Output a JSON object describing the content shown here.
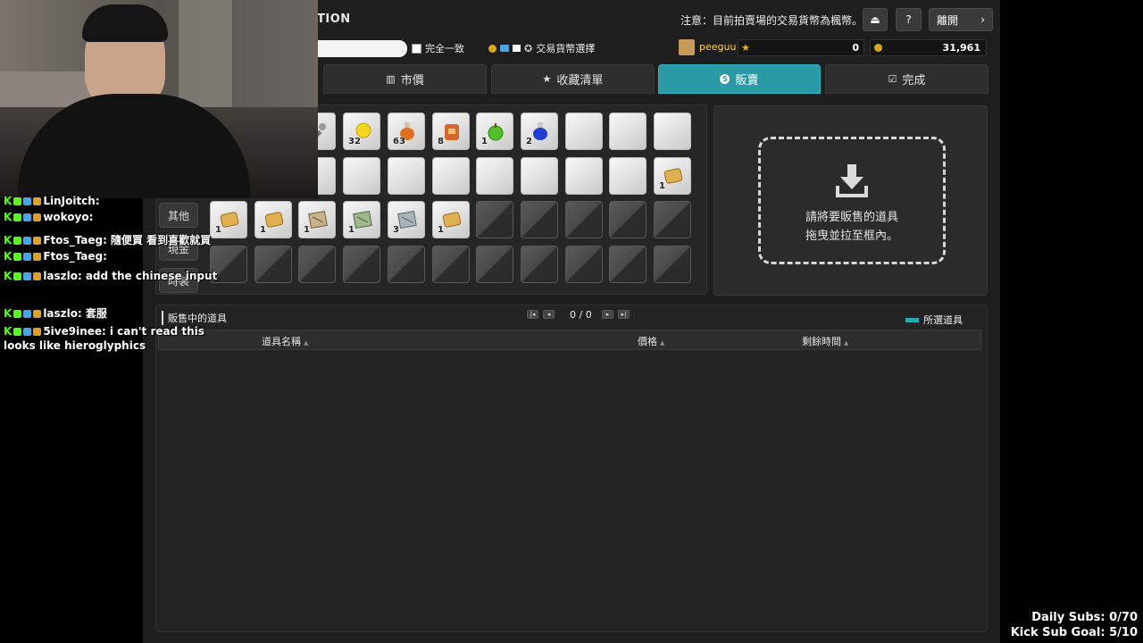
{
  "window": {
    "title": "TION",
    "notice": "注意：目前拍賣場的交易貨幣為楓幣。",
    "leave_label": "離開",
    "help_label": "?"
  },
  "search": {
    "exact_match_label": "完全一致",
    "currency_select_label": "交易貨幣選擇"
  },
  "account": {
    "username": "peeguu",
    "star_points": "0",
    "mesos": "31,961"
  },
  "tabs": [
    {
      "label": "市價",
      "icon": "bar-chart-icon"
    },
    {
      "label": "收藏清單",
      "icon": "star-icon"
    },
    {
      "label": "販賣",
      "icon": "coin-s-icon",
      "active": true
    },
    {
      "label": "完成",
      "icon": "checkbox-icon"
    }
  ],
  "inventory": {
    "side_tabs": [
      "其他",
      "現金",
      "時裝"
    ],
    "rows": [
      [
        {
          "type": "tool",
          "qty": ""
        },
        {
          "type": "yellow-orb",
          "qty": "32"
        },
        {
          "type": "potion-orange",
          "qty": "63"
        },
        {
          "type": "bag-orange",
          "qty": "8"
        },
        {
          "type": "apple",
          "qty": "1"
        },
        {
          "type": "potion-blue",
          "qty": "2"
        },
        {
          "type": "empty",
          "qty": ""
        },
        {
          "type": "empty",
          "qty": ""
        },
        {
          "type": "empty",
          "qty": ""
        }
      ],
      [
        {
          "type": "empty",
          "qty": ""
        },
        {
          "type": "empty",
          "qty": ""
        },
        {
          "type": "empty",
          "qty": ""
        },
        {
          "type": "empty",
          "qty": ""
        },
        {
          "type": "empty",
          "qty": ""
        },
        {
          "type": "empty",
          "qty": ""
        },
        {
          "type": "empty",
          "qty": ""
        },
        {
          "type": "empty",
          "qty": ""
        },
        {
          "type": "scroll-gold",
          "qty": "1"
        }
      ],
      [
        {
          "type": "scroll-gold",
          "qty": "1"
        },
        {
          "type": "scroll-gold",
          "qty": "1"
        },
        {
          "type": "map-brown",
          "qty": "1"
        },
        {
          "type": "map-green",
          "qty": "1"
        },
        {
          "type": "map-gray",
          "qty": "3"
        },
        {
          "type": "scroll-gold",
          "qty": "1"
        },
        {
          "type": "locked",
          "qty": ""
        },
        {
          "type": "locked",
          "qty": ""
        },
        {
          "type": "locked",
          "qty": ""
        },
        {
          "type": "locked",
          "qty": ""
        },
        {
          "type": "locked",
          "qty": ""
        }
      ],
      [
        {
          "type": "locked",
          "qty": ""
        },
        {
          "type": "locked",
          "qty": ""
        },
        {
          "type": "locked",
          "qty": ""
        },
        {
          "type": "locked",
          "qty": ""
        },
        {
          "type": "locked",
          "qty": ""
        },
        {
          "type": "locked",
          "qty": ""
        },
        {
          "type": "locked",
          "qty": ""
        },
        {
          "type": "locked",
          "qty": ""
        },
        {
          "type": "locked",
          "qty": ""
        },
        {
          "type": "locked",
          "qty": ""
        },
        {
          "type": "locked",
          "qty": ""
        }
      ]
    ]
  },
  "drop_zone": {
    "line1": "請將要販售的道具",
    "line2": "拖曳並拉至框內。"
  },
  "selling": {
    "title": "販售中的道具",
    "page": "0 / 0",
    "legend": "所選道具",
    "columns": [
      "道具名稱",
      "價格",
      "剩餘時間"
    ]
  },
  "chat": [
    {
      "user": "LinJoitch:",
      "msg": ""
    },
    {
      "user": "wokoyo:",
      "msg": ""
    },
    {
      "user": "Ftos_Taeg:",
      "msg": "隨便買 看到喜歡就買"
    },
    {
      "user": "Ftos_Taeg:",
      "msg": ""
    },
    {
      "user": "laszlo:",
      "msg": "add the chinese input"
    },
    {
      "user": "",
      "msg": ""
    },
    {
      "user": "laszlo:",
      "msg": "套服"
    },
    {
      "user": "5ive9inee:",
      "msg": "i can't read this"
    },
    {
      "user": "",
      "msg": "looks like hieroglyphics"
    }
  ],
  "stream_stats": {
    "daily_subs": "Daily Subs: 0/70",
    "kick_goal": "Kick Sub Goal: 5/10"
  },
  "colors": {
    "accent_teal": "#2a9aa5",
    "kick_green": "#53fc18",
    "coin_gold": "#d9a919"
  }
}
